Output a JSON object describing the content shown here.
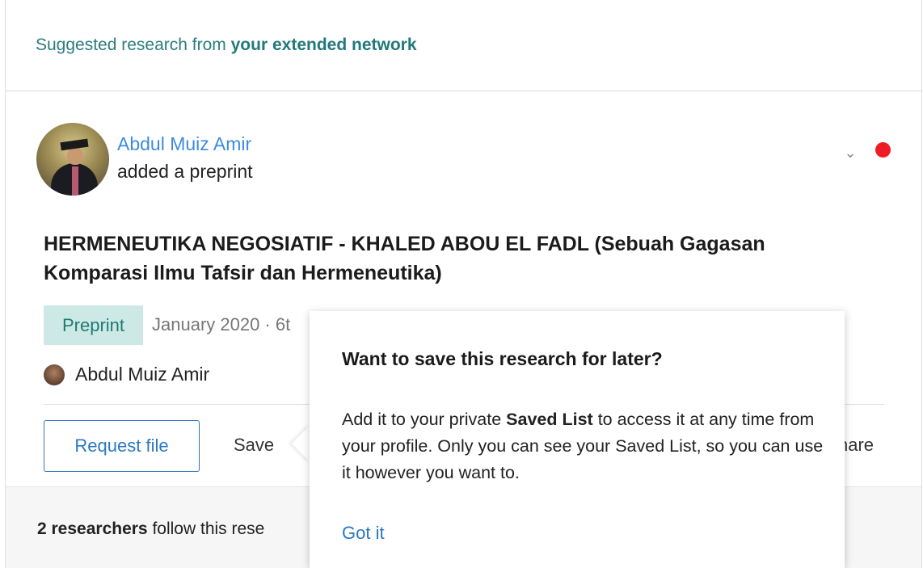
{
  "suggestion": {
    "prefix": "Suggested research from ",
    "emphasis": "your extended network"
  },
  "post": {
    "author_name": "Abdul Muiz Amir",
    "action": "added a preprint",
    "title": "HERMENEUTIKA NEGOSIATIF - KHALED ABOU EL FADL (Sebuah Gagasan Komparasi Ilmu Tafsir dan Hermeneutika)",
    "badge": "Preprint",
    "meta": "January 2020 · 6t",
    "author_line": "Abdul Muiz Amir"
  },
  "actions": {
    "request_file": "Request file",
    "save": "Save",
    "share": "hare"
  },
  "footer": {
    "count_bold": "2 researchers",
    "rest": " follow this rese"
  },
  "popover": {
    "title": "Want to save this research for later?",
    "body_prefix": "Add it to your private ",
    "body_bold": "Saved List",
    "body_suffix": " to access it at any time from your profile. Only you can see your Saved List, so you can use it however you want to.",
    "got_it": "Got it"
  },
  "icons": {
    "chevron": "chevron-down-icon",
    "notification": "red-dot-icon"
  },
  "colors": {
    "accent_teal": "#20797b",
    "link_blue": "#2a78c2",
    "badge_bg": "#cde9e6",
    "notification_red": "#ee1c24"
  }
}
